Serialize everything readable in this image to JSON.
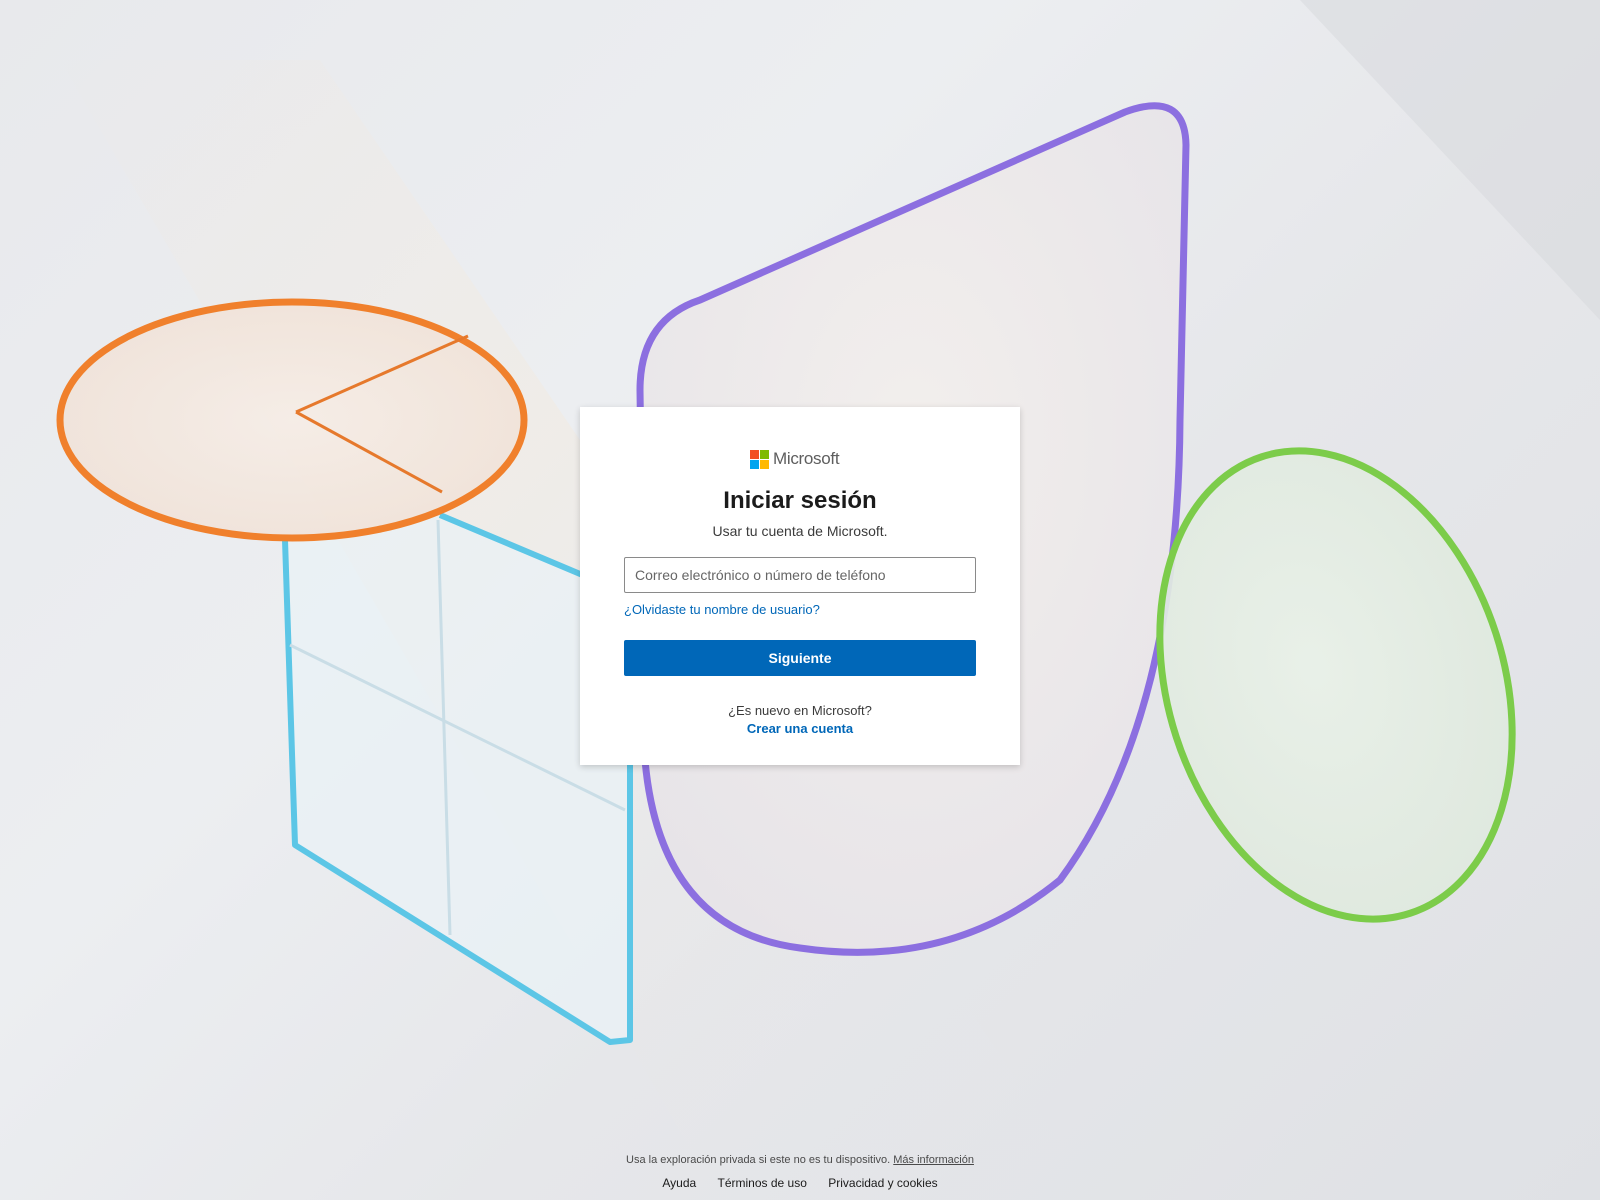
{
  "brand": {
    "name": "Microsoft",
    "logo_colors": [
      "#f25022",
      "#7fba00",
      "#00a4ef",
      "#ffb900"
    ]
  },
  "signin": {
    "title": "Iniciar sesión",
    "subtitle": "Usar tu cuenta de Microsoft.",
    "email_placeholder": "Correo electrónico o número de teléfono",
    "email_value": "",
    "forgot_username": "¿Olvidaste tu nombre de usuario?",
    "next_label": "Siguiente",
    "new_prompt": "¿Es nuevo en Microsoft?",
    "create_account": "Crear una cuenta"
  },
  "footer": {
    "private_note": "Usa la exploración privada si este no es tu dispositivo.",
    "more_info": "Más información",
    "links": [
      "Ayuda",
      "Términos de uso",
      "Privacidad y cookies"
    ]
  },
  "colors": {
    "accent": "#0067b8",
    "shape_orange": "#f0802c",
    "shape_blue": "#5cc6e6",
    "shape_purple": "#8c6fe0",
    "shape_green": "#7ccc4a"
  }
}
